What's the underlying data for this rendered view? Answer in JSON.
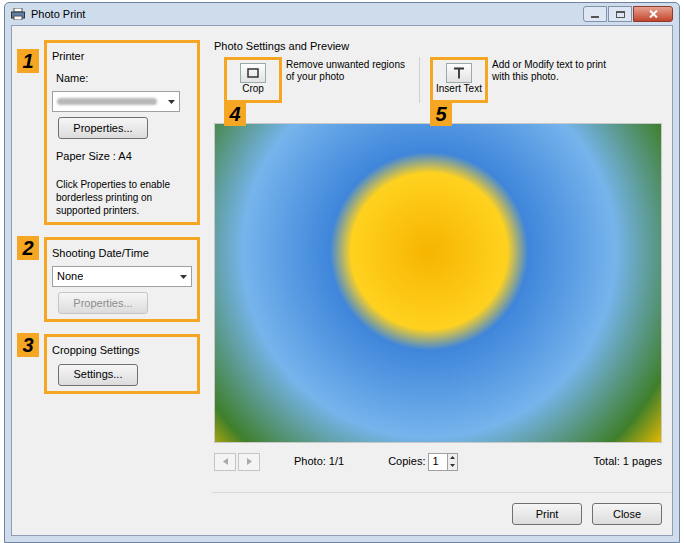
{
  "window": {
    "title": "Photo Print"
  },
  "printer": {
    "heading": "Printer",
    "name_label": "Name:",
    "properties_button": "Properties...",
    "paper_size": "Paper Size : A4",
    "note": "Click Properties to enable borderless printing on supported printers.",
    "callout": "1"
  },
  "shooting": {
    "heading": "Shooting Date/Time",
    "value": "None",
    "properties_button": "Properties...",
    "properties_disabled": true,
    "callout": "2"
  },
  "cropping": {
    "heading": "Cropping Settings",
    "button": "Settings...",
    "callout": "3"
  },
  "preview": {
    "heading": "Photo Settings and Preview",
    "tools": [
      {
        "label": "Crop",
        "description": "Remove unwanted regions of your photo",
        "callout": "4"
      },
      {
        "label": "Insert Text",
        "description": "Add or Modify text to print with this photo.",
        "callout": "5"
      }
    ]
  },
  "navigation": {
    "prev_disabled": true,
    "next_disabled": true,
    "photo": "Photo: 1/1",
    "copies_label": "Copies:",
    "copies": "1",
    "total": "Total: 1 pages"
  },
  "buttons": [
    {
      "label": "Print"
    },
    {
      "label": "Close"
    }
  ]
}
